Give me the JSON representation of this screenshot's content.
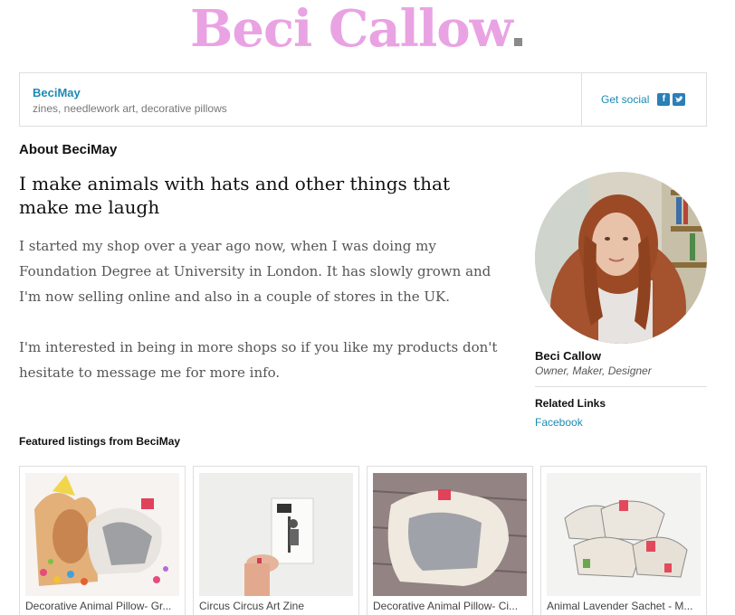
{
  "header": {
    "logo_text": "Beci Callow",
    "logo_color": "#e9a3e3"
  },
  "shop": {
    "name": "BeciMay",
    "tagline": "zines, needlework art, decorative pillows",
    "social_label": "Get social",
    "social_icons": [
      "facebook-icon",
      "twitter-icon"
    ],
    "accent_color": "#1c8bb5"
  },
  "about": {
    "heading": "About BeciMay",
    "headline": "I make animals with hats and other things that make me laugh",
    "paragraphs": [
      "I started my shop over a year ago now, when I was doing my Foundation Degree at University in London. It has slowly grown and I'm now selling online and also in a couple of stores in the UK.",
      "I'm interested in being in more shops so if you like my products don't hesitate to message me for more info."
    ]
  },
  "owner": {
    "name": "Beci Callow",
    "role": "Owner, Maker, Designer",
    "related_heading": "Related Links",
    "related_links": [
      "Facebook"
    ]
  },
  "featured": {
    "heading": "Featured listings from BeciMay",
    "listings": [
      {
        "title": "Decorative Animal Pillow- Gr..."
      },
      {
        "title": "Circus Circus Art Zine"
      },
      {
        "title": "Decorative Animal Pillow- Ci..."
      },
      {
        "title": "Animal Lavender Sachet - M..."
      }
    ]
  }
}
